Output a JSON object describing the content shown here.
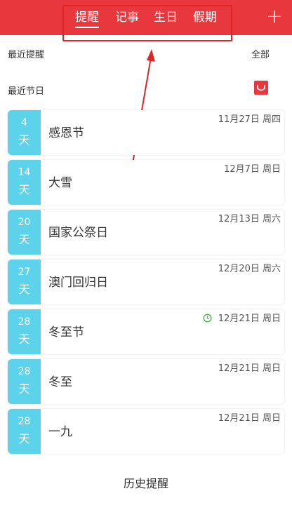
{
  "header": {
    "tabs": [
      {
        "label": "提醒",
        "active": true
      },
      {
        "label": "记事",
        "active": false
      },
      {
        "label": "生日",
        "active": false
      },
      {
        "label": "假期",
        "active": false
      }
    ],
    "add_icon": "plus-icon",
    "accent_color": "#e8383d"
  },
  "recent_reminders": {
    "label": "最近提醒",
    "all_link": "全部"
  },
  "recent_holidays": {
    "label": "最近节日",
    "icon": "gift-icon"
  },
  "items": [
    {
      "days": "4",
      "unit": "天",
      "name": "感恩节",
      "date": "11月27日 周四"
    },
    {
      "days": "14",
      "unit": "天",
      "name": "大雪",
      "date": "12月7日 周日"
    },
    {
      "days": "20",
      "unit": "天",
      "name": "国家公祭日",
      "date": "12月13日 周六"
    },
    {
      "days": "27",
      "unit": "天",
      "name": "澳门回归日",
      "date": "12月20日 周六"
    },
    {
      "days": "28",
      "unit": "天",
      "name": "冬至节",
      "date": "12月21日 周日",
      "has_alarm": true
    },
    {
      "days": "28",
      "unit": "天",
      "name": "冬至",
      "date": "12月21日 周日"
    },
    {
      "days": "28",
      "unit": "天",
      "name": "一九",
      "date": "12月21日 周日"
    }
  ],
  "footer": {
    "history_label": "历史提醒"
  },
  "colors": {
    "days_badge": "#5cd3ea",
    "alarm": "#4caf50"
  }
}
